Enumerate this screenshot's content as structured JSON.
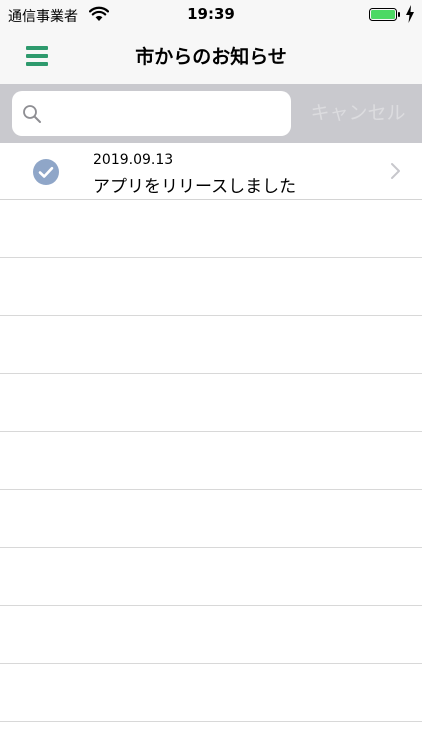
{
  "status_bar": {
    "carrier": "通信事業者",
    "time": "19:39",
    "icons": [
      "wifi-icon",
      "battery-icon",
      "charging-icon"
    ],
    "battery_color": "#4cd964"
  },
  "nav": {
    "title": "市からのお知らせ",
    "menu_icon": "hamburger-menu-icon",
    "accent_color": "#2e9a6d"
  },
  "search": {
    "value": "",
    "placeholder": "",
    "cancel_label": "キャンセル"
  },
  "notices": [
    {
      "date": "2019.09.13",
      "title": "アプリをリリースしました",
      "status": "read",
      "icon": "check-circle-icon"
    }
  ]
}
